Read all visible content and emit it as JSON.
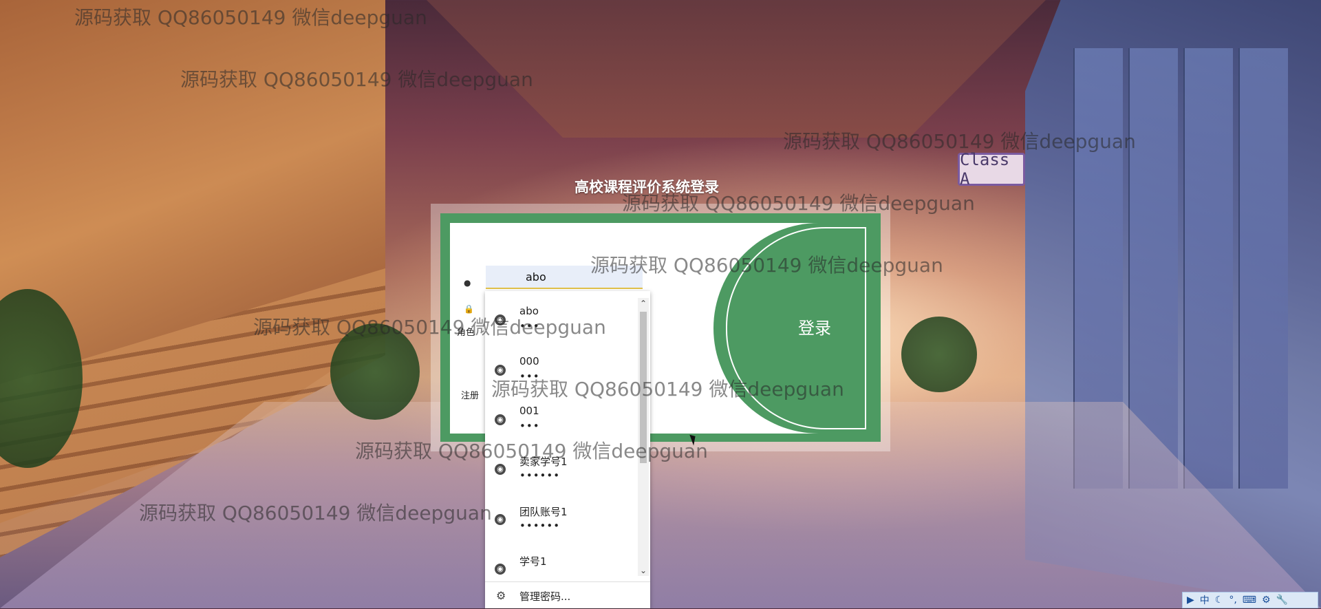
{
  "login": {
    "title": "高校课程评价系统登录",
    "username_value": "abo",
    "role_label": "角色",
    "register_label": "注册",
    "login_button": "登录"
  },
  "autocomplete": {
    "items": [
      {
        "name": "abo",
        "password": "•••"
      },
      {
        "name": "000",
        "password": "•••"
      },
      {
        "name": "001",
        "password": "•••"
      },
      {
        "name": "卖家学号1",
        "password": "••••••"
      },
      {
        "name": "团队账号1",
        "password": "••••••"
      },
      {
        "name": "学号1",
        "password": ""
      }
    ],
    "manage_label": "管理密码..."
  },
  "background": {
    "class_sign": "Class A"
  },
  "watermark": {
    "text": "源码获取 QQ86050149 微信deepguan"
  },
  "tray": {
    "items": [
      "中",
      "☾",
      "°,",
      "⌨",
      "⚙",
      "🔧"
    ]
  }
}
